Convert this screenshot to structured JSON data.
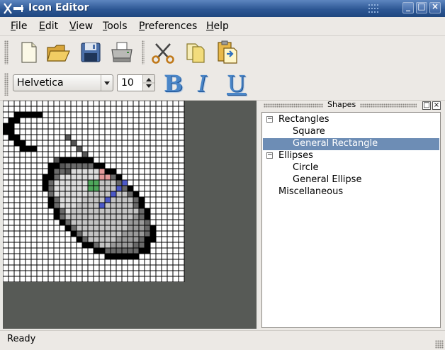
{
  "window": {
    "title": "Icon Editor"
  },
  "menu": [
    {
      "label": "File",
      "mnemonic": "F",
      "rest": "ile"
    },
    {
      "label": "Edit",
      "mnemonic": "E",
      "rest": "dit"
    },
    {
      "label": "View",
      "mnemonic": "V",
      "rest": "iew"
    },
    {
      "label": "Tools",
      "mnemonic": "T",
      "rest": "ools"
    },
    {
      "label": "Preferences",
      "mnemonic": "P",
      "rest": "references"
    },
    {
      "label": "Help",
      "mnemonic": "H",
      "rest": "elp"
    }
  ],
  "toolbar": {
    "icons": [
      "new-file-icon",
      "open-folder-icon",
      "save-icon",
      "print-icon",
      "cut-icon",
      "copy-icon",
      "paste-icon"
    ]
  },
  "format_toolbar": {
    "font": "Helvetica",
    "size": "10",
    "bold": "B",
    "italic": "I",
    "underline": "U"
  },
  "dock": {
    "title": "Shapes",
    "tree": [
      {
        "label": "Rectangles",
        "level": 0,
        "expanded": true
      },
      {
        "label": "Square",
        "level": 1
      },
      {
        "label": "General Rectangle",
        "level": 1,
        "selected": true
      },
      {
        "label": "Ellipses",
        "level": 0,
        "expanded": true
      },
      {
        "label": "Circle",
        "level": 1
      },
      {
        "label": "General Ellipse",
        "level": 1
      },
      {
        "label": "Miscellaneous",
        "level": 0
      }
    ]
  },
  "status": {
    "text": "Ready"
  },
  "colors": {
    "titlebar": "#2d5794",
    "selection": "#6d8db5",
    "canvas_bg": "#575a56"
  }
}
